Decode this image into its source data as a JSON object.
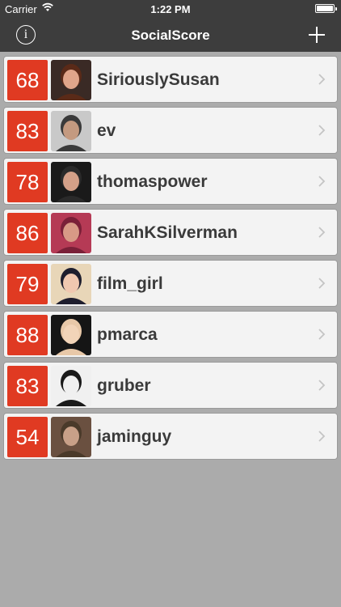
{
  "status_bar": {
    "carrier": "Carrier",
    "time": "1:22 PM",
    "wifi_icon": "wifi-icon",
    "battery_icon": "battery-icon"
  },
  "nav": {
    "title": "SocialScore",
    "info_icon": "info-icon",
    "info_glyph": "i",
    "add_icon": "plus-icon",
    "add_glyph": "+"
  },
  "colors": {
    "bar": "#3d3d3d",
    "score_badge": "#e03a22",
    "background": "#ababab",
    "row": "#f3f3f3"
  },
  "users": [
    {
      "score": "68",
      "name": "SiriouslySusan",
      "avatar_bg": "#3a2a25",
      "avatar_fg": "#e0a58a",
      "avatar_hair": "#5a2a18"
    },
    {
      "score": "83",
      "name": "ev",
      "avatar_bg": "#c9c9c9",
      "avatar_fg": "#c49a80",
      "avatar_hair": "#3a3a3a"
    },
    {
      "score": "78",
      "name": "thomaspower",
      "avatar_bg": "#1a1a1a",
      "avatar_fg": "#d4a088",
      "avatar_hair": "#2a2a2a"
    },
    {
      "score": "86",
      "name": "SarahKSilverman",
      "avatar_bg": "#b53a55",
      "avatar_fg": "#d89a86",
      "avatar_hair": "#7a2038"
    },
    {
      "score": "79",
      "name": "film_girl",
      "avatar_bg": "#e8d6b8",
      "avatar_fg": "#f0c8b0",
      "avatar_hair": "#1e1e2e"
    },
    {
      "score": "88",
      "name": "pmarca",
      "avatar_bg": "#151515",
      "avatar_fg": "#f2d4b8",
      "avatar_hair": "#e8c8a8"
    },
    {
      "score": "83",
      "name": "gruber",
      "avatar_bg": "#f0f0f0",
      "avatar_fg": "#f0f0f0",
      "avatar_hair": "#1a1a1a"
    },
    {
      "score": "54",
      "name": "jaminguy",
      "avatar_bg": "#6a5040",
      "avatar_fg": "#c8a088",
      "avatar_hair": "#4a3a2a"
    }
  ]
}
